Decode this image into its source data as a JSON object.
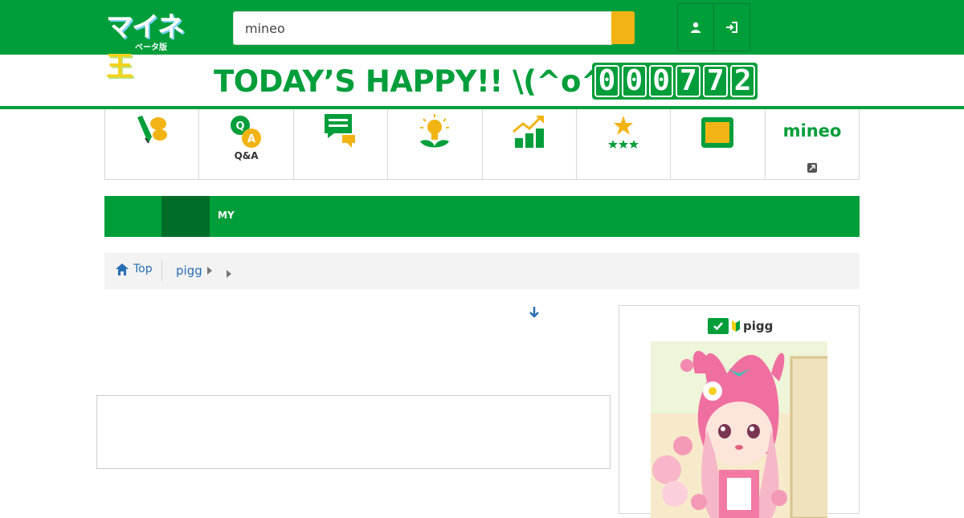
{
  "header": {
    "logo_main": "マイネ",
    "logo_king": "王",
    "logo_sub": "ベータ版",
    "search_value": "mineo",
    "search_icon": "search-icon",
    "user_icon": "user-icon",
    "login_icon": "login-icon"
  },
  "happy": {
    "text": "TODAY’S HAPPY!! \\(^o^)/",
    "digits": [
      "0",
      "0",
      "0",
      "7",
      "7",
      "2"
    ]
  },
  "categories": [
    {
      "icon": "pen-chat-icon",
      "label": ""
    },
    {
      "icon": "qa-icon",
      "label": "Q&A"
    },
    {
      "icon": "comments-icon",
      "label": ""
    },
    {
      "icon": "idea-bulb-icon",
      "label": ""
    },
    {
      "icon": "trend-chart-icon",
      "label": ""
    },
    {
      "icon": "stars-icon",
      "label": ""
    },
    {
      "icon": "folder-icon",
      "label": ""
    },
    {
      "icon": "mineo-logo-icon",
      "label": "mineo"
    }
  ],
  "mybar": {
    "label": "MY"
  },
  "breadcrumb": {
    "home_label": "Top",
    "items": [
      "pigg"
    ]
  },
  "profile": {
    "name": "pigg"
  },
  "colors": {
    "brand_green": "#009e3a",
    "dark_green": "#006e28",
    "search_yellow": "#f2b414",
    "link_blue": "#2a6fb5"
  }
}
